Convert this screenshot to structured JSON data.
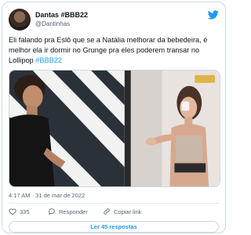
{
  "tweet": {
    "display_name": "Dantas #BBB22",
    "handle": "@Dantinhas",
    "text_main": "Eli falando pra Eslô que se a Natália melhorar da bebedeira, é melhor ela ir dormir no Grunge pra eles poderem transar no Lollipop ",
    "hashtag": "#BBB22",
    "timestamp": "4:17 AM · 31 de mar de 2022"
  },
  "actions": {
    "like_count": "335",
    "reply_label": "Responder",
    "copy_label": "Copiar link"
  },
  "replies_button": "Ler 45 respostas",
  "colors": {
    "accent": "#1d9bf0",
    "like": "#f91880",
    "text": "#0f1419",
    "secondary": "#536471"
  },
  "icons": {
    "brand": "twitter-bird-icon",
    "like": "heart-icon",
    "reply": "reply-bubble-icon",
    "copy": "link-icon"
  }
}
